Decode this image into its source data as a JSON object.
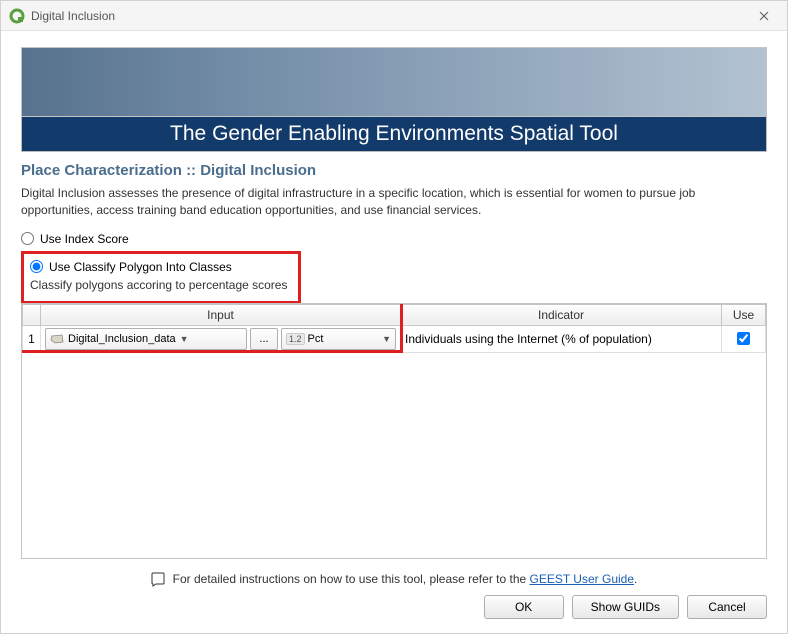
{
  "window": {
    "title": "Digital Inclusion"
  },
  "banner": {
    "title": "The Gender Enabling Environments Spatial Tool"
  },
  "section": {
    "title": "Place Characterization :: Digital Inclusion",
    "description": "Digital Inclusion assesses the presence of digital infrastructure in a specific location, which is essential for women to pursue job opportunities, access training band education opportunities, and use financial services."
  },
  "options": {
    "use_index_score": "Use Index Score",
    "use_classify": "Use Classify Polygon Into Classes",
    "classify_note": "Classify polygons accoring to percentage scores"
  },
  "table": {
    "headers": {
      "input": "Input",
      "indicator": "Indicator",
      "use": "Use"
    },
    "rows": [
      {
        "num": "1",
        "data_layer": "Digital_Inclusion_data",
        "browse": "...",
        "field_type": "1.2",
        "field_name": "Pct",
        "indicator": "Individuals using the Internet (% of population)",
        "use_checked": true
      }
    ]
  },
  "footer": {
    "note_prefix": "For detailed instructions on how to use this tool, please refer to the ",
    "link_text": "GEEST User Guide",
    "note_suffix": "."
  },
  "buttons": {
    "ok": "OK",
    "show_guids": "Show GUIDs",
    "cancel": "Cancel"
  }
}
